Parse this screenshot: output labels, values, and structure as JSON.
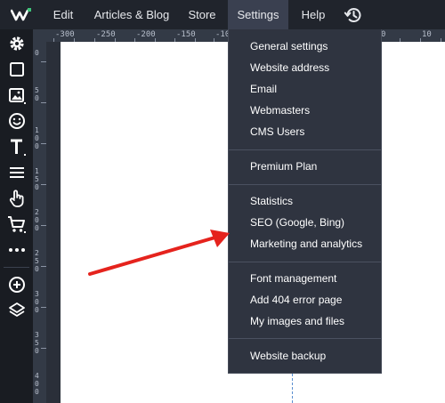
{
  "menubar": {
    "items": [
      {
        "label": "Edit"
      },
      {
        "label": "Articles & Blog"
      },
      {
        "label": "Store"
      },
      {
        "label": "Settings"
      },
      {
        "label": "Help"
      }
    ]
  },
  "toolbar": {
    "icons": [
      "gear-icon",
      "square-icon",
      "image-icon",
      "smiley-icon",
      "text-icon",
      "menu-lines-icon",
      "hand-pointer-icon",
      "cart-icon",
      "more-icon",
      "add-circle-icon",
      "layers-icon"
    ]
  },
  "rulers": {
    "horizontal": [
      "-300",
      "-250",
      "-200",
      "-150",
      "-10",
      "0",
      "10"
    ],
    "vertical": [
      "0",
      "50",
      "100",
      "150",
      "200",
      "250",
      "300",
      "350",
      "400"
    ]
  },
  "settings_menu": {
    "groups": [
      [
        "General settings",
        "Website address",
        "Email",
        "Webmasters",
        "CMS Users"
      ],
      [
        "Premium Plan"
      ],
      [
        "Statistics",
        "SEO (Google, Bing)",
        "Marketing and analytics"
      ],
      [
        "Font management",
        "Add 404 error page",
        "My images and files"
      ],
      [
        "Website backup"
      ]
    ]
  },
  "colors": {
    "topbar": "#20242c",
    "toolbar": "#191c22",
    "dropdown": "#2f3440",
    "active_menu": "#3a4050",
    "arrow": "#e5231d"
  }
}
